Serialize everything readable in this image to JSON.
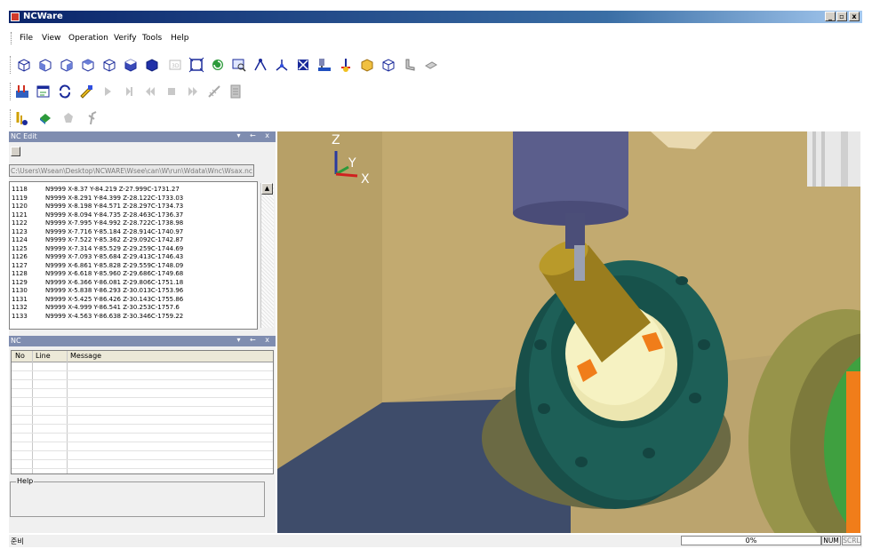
{
  "window": {
    "title": "NCWare",
    "minimize": "_",
    "maximize": "¥",
    "close": "x"
  },
  "menu": {
    "items": [
      "File",
      "View",
      "Operation",
      "Verify",
      "Tools",
      "Help"
    ]
  },
  "toolbars": {
    "row1": [
      "view-iso-icon",
      "view-front-icon",
      "view-back-icon",
      "view-left-icon",
      "view-right-icon",
      "view-top-icon",
      "view-solid-icon",
      "dimension-icon",
      "fit-window-icon",
      "rotate-icon",
      "zoom-icon",
      "toolpath-icon",
      "axis-icon",
      "grid-icon",
      "machine-icon",
      "coordinate-icon",
      "stock-icon",
      "wireframe-icon",
      "fixture-icon",
      "eraser-icon"
    ],
    "row2": [
      "settings-icon",
      "editor-icon",
      "reload-icon",
      "simulate-icon",
      "play-icon",
      "step-icon",
      "rewind-icon",
      "stop-icon",
      "fast-forward-icon",
      "measure-icon",
      "report-icon"
    ],
    "row3": [
      "tool-path-icon",
      "machine-view-icon",
      "collision-icon",
      "cut-icon"
    ]
  },
  "nc_edit": {
    "title": "NC Edit",
    "controls": "▾ ← x",
    "path": "C:\\Users\\Wsean\\Desktop\\NCWARE\\Wsee\\can\\W\\run\\Wdata\\Wnc\\Wsax.nc",
    "lines": [
      {
        "num": "1118",
        "code": "N9999 X-8.37 Y-84.219 Z-27.999C-1731.27"
      },
      {
        "num": "1119",
        "code": "N9999 X-8.291 Y-84.399 Z-28.122C-1733.03"
      },
      {
        "num": "1120",
        "code": "N9999 X-8.198 Y-84.571 Z-28.297C-1734.73"
      },
      {
        "num": "1121",
        "code": "N9999 X-8.094 Y-84.735 Z-28.463C-1736.37"
      },
      {
        "num": "1122",
        "code": "N9999 X-7.995 Y-84.992 Z-28.722C-1738.98"
      },
      {
        "num": "1123",
        "code": "N9999 X-7.716 Y-85.184 Z-28.914C-1740.97"
      },
      {
        "num": "1124",
        "code": "N9999 X-7.522 Y-85.362 Z-29.092C-1742.87"
      },
      {
        "num": "1125",
        "code": "N9999 X-7.314 Y-85.529 Z-29.259C-1744.69"
      },
      {
        "num": "1126",
        "code": "N9999 X-7.093 Y-85.684 Z-29.413C-1746.43"
      },
      {
        "num": "1127",
        "code": "N9999 X-6.861 Y-85.828 Z-29.559C-1748.09"
      },
      {
        "num": "1128",
        "code": "N9999 X-6.618 Y-85.960 Z-29.686C-1749.68"
      },
      {
        "num": "1129",
        "code": "N9999 X-6.366 Y-86.081 Z-29.806C-1751.18"
      },
      {
        "num": "1130",
        "code": "N9999 X-5.838 Y-86.293 Z-30.013C-1753.96"
      },
      {
        "num": "1131",
        "code": "N9999 X-5.425 Y-86.426 Z-30.143C-1755.86"
      },
      {
        "num": "1132",
        "code": "N9999 X-4.999 Y-86.541 Z-30.253C-1757.6"
      },
      {
        "num": "1133",
        "code": "N9999 X-4.563 Y-86.638 Z-30.346C-1759.22"
      }
    ]
  },
  "nc_panel": {
    "title": "NC",
    "controls": "▾ ← x",
    "columns": [
      "No",
      "Line",
      "Message"
    ],
    "help_label": "Help"
  },
  "viewport": {
    "axis_z": "Z",
    "axis_y": "Y",
    "axis_x": "X"
  },
  "status": {
    "ready": "준비",
    "progress": "0%",
    "num": "NUM",
    "scrl": "SCRL"
  },
  "colors": {
    "title_bar": "#0a246a",
    "panel_header": "#7f8db0",
    "wall": "#bba46e",
    "floor": "#3f4d6b",
    "table": "#1d5f57",
    "tool_holder": "#9a7d1e",
    "workpiece": "#f6f2c2",
    "insert": "#f07d1a",
    "spindle": "#5b5e8c",
    "rotary": "#97944a",
    "rotary_green": "#3fa040"
  }
}
